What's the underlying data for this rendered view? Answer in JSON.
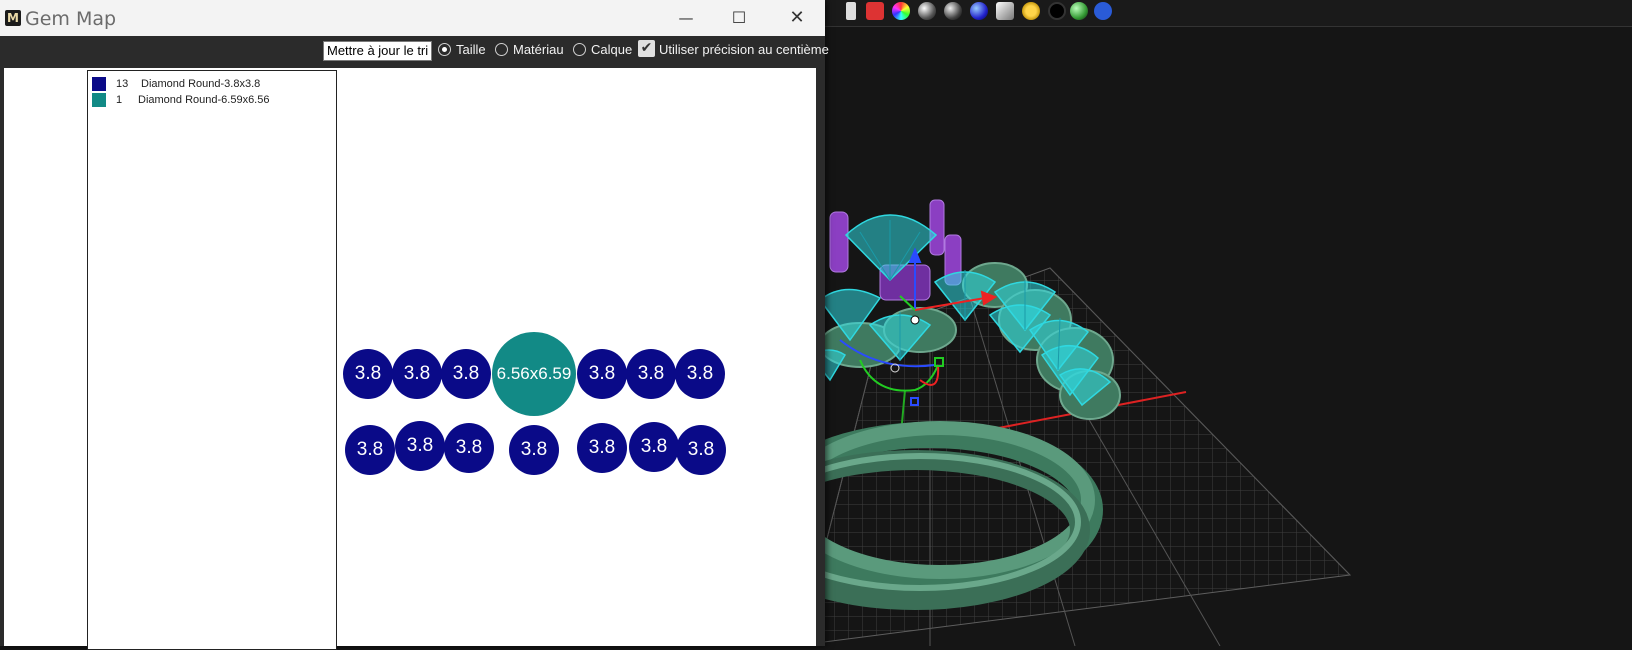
{
  "window": {
    "title": "Gem Map",
    "app_icon": "M",
    "minimize_icon": "minimize-icon",
    "maximize_icon": "maximize-icon",
    "close_icon": "close-icon"
  },
  "options": {
    "update_sort_label": "Mettre à jour le tri",
    "sort_options": [
      {
        "label": "Taille",
        "checked": true
      },
      {
        "label": "Matériau",
        "checked": false
      },
      {
        "label": "Calque",
        "checked": false
      }
    ],
    "hundredth_precision_label": "Utiliser précision au centième",
    "hundredth_precision_checked": true
  },
  "legend": [
    {
      "count": "13",
      "name": "Diamond Round-3.8x3.8",
      "color": "#0a0a88"
    },
    {
      "count": "1",
      "name": "Diamond Round-6.59x6.56",
      "color": "#128a86"
    }
  ],
  "gems_row1": [
    "3.8",
    "3.8",
    "3.8",
    "6.56x6.59",
    "3.8",
    "3.8",
    "3.8"
  ],
  "gems_row2": [
    "3.8",
    "3.8",
    "3.8",
    "3.8",
    "3.8",
    "3.8",
    "3.8"
  ],
  "colors": {
    "small_gem": "#0a0a88",
    "large_gem": "#128a86",
    "viewport_bg": "#151515",
    "wire_gem": "#2fd8e0",
    "ring": "#4a8a6a"
  }
}
